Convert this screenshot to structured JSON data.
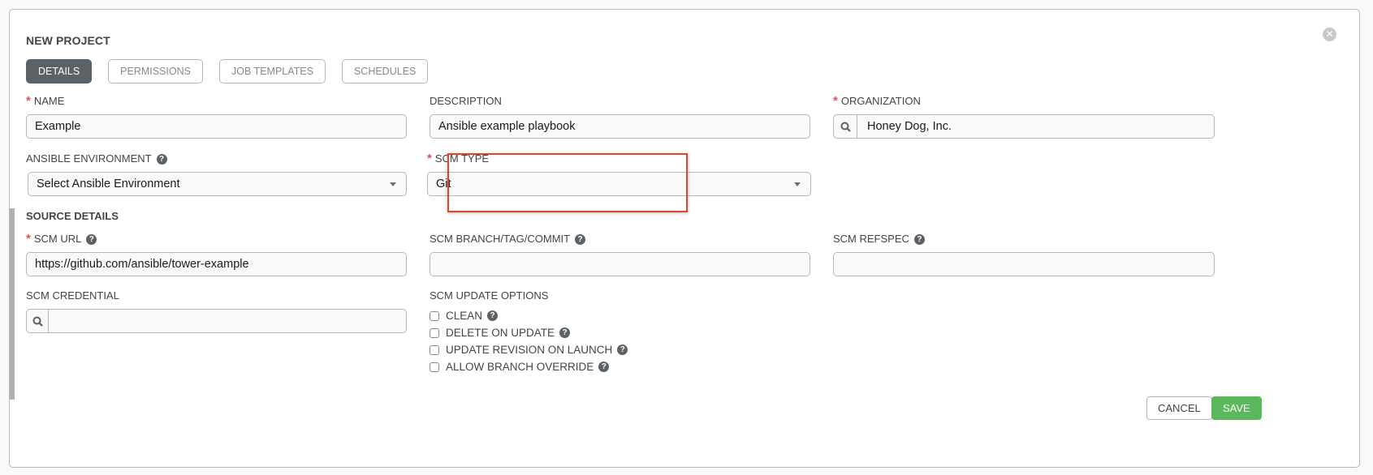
{
  "dialog": {
    "title": "NEW PROJECT",
    "close_icon": "times-circle-icon"
  },
  "tabs": [
    {
      "label": "DETAILS",
      "active": true
    },
    {
      "label": "PERMISSIONS",
      "active": false
    },
    {
      "label": "JOB TEMPLATES",
      "active": false
    },
    {
      "label": "SCHEDULES",
      "active": false
    }
  ],
  "fields": {
    "name": {
      "label": "NAME",
      "required": true,
      "value": "Example"
    },
    "description": {
      "label": "DESCRIPTION",
      "required": false,
      "value": "Ansible example playbook"
    },
    "organization": {
      "label": "ORGANIZATION",
      "required": true,
      "value": "Honey Dog, Inc.",
      "icon": "search-icon"
    },
    "ansible_environment": {
      "label": "ANSIBLE ENVIRONMENT",
      "help": true,
      "value": "Select Ansible Environment"
    },
    "scm_type": {
      "label": "SCM TYPE",
      "required": true,
      "value": "Git",
      "highlighted": true
    }
  },
  "source_details": {
    "title": "SOURCE DETAILS",
    "scm_url": {
      "label": "SCM URL",
      "required": true,
      "help": true,
      "value": "https://github.com/ansible/tower-example"
    },
    "scm_branch": {
      "label": "SCM BRANCH/TAG/COMMIT",
      "help": true,
      "value": ""
    },
    "scm_refspec": {
      "label": "SCM REFSPEC",
      "help": true,
      "value": ""
    },
    "scm_credential": {
      "label": "SCM CREDENTIAL",
      "value": "",
      "icon": "search-icon"
    },
    "update_options": {
      "label": "SCM UPDATE OPTIONS",
      "options": [
        {
          "label": "CLEAN",
          "checked": false,
          "help": true
        },
        {
          "label": "DELETE ON UPDATE",
          "checked": false,
          "help": true
        },
        {
          "label": "UPDATE REVISION ON LAUNCH",
          "checked": false,
          "help": true
        },
        {
          "label": "ALLOW BRANCH OVERRIDE",
          "checked": false,
          "help": true
        }
      ]
    }
  },
  "help_glyph": "?",
  "close_glyph": "✕",
  "required_glyph": "*",
  "actions": {
    "cancel": "CANCEL",
    "save": "SAVE"
  },
  "colors": {
    "save": "#5cb85c",
    "active_tab": "#5c6166",
    "required": "#d9534f",
    "highlight": "#e8412c"
  }
}
